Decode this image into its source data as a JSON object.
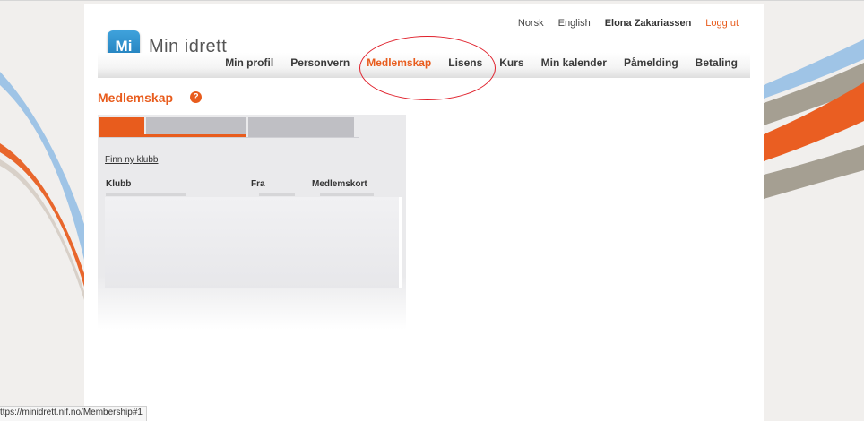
{
  "header": {
    "links": {
      "norsk": "Norsk",
      "english": "English",
      "user": "Elona Zakariassen",
      "logout": "Logg ut"
    },
    "logo": {
      "badge": "Mi",
      "text": "Min idrett"
    }
  },
  "nav": {
    "items": [
      {
        "label": "Min profil"
      },
      {
        "label": "Personvern"
      },
      {
        "label": "Medlemskap",
        "active": true
      },
      {
        "label": "Lisens"
      },
      {
        "label": "Kurs"
      },
      {
        "label": "Min kalender"
      },
      {
        "label": "Påmelding"
      },
      {
        "label": "Betaling"
      }
    ]
  },
  "main": {
    "title": "Medlemskap",
    "help_symbol": "?",
    "find_club_link": "Finn ny klubb",
    "table": {
      "headers": {
        "club": "Klubb",
        "from": "Fra",
        "card": "Medlemskort"
      }
    }
  },
  "statusbar": {
    "url": "ttps://minidrett.nif.no/Membership#1"
  },
  "colors": {
    "accent": "#e85c1d",
    "annotation": "#e01f2a",
    "logo_blue": "#2a8ccd"
  }
}
